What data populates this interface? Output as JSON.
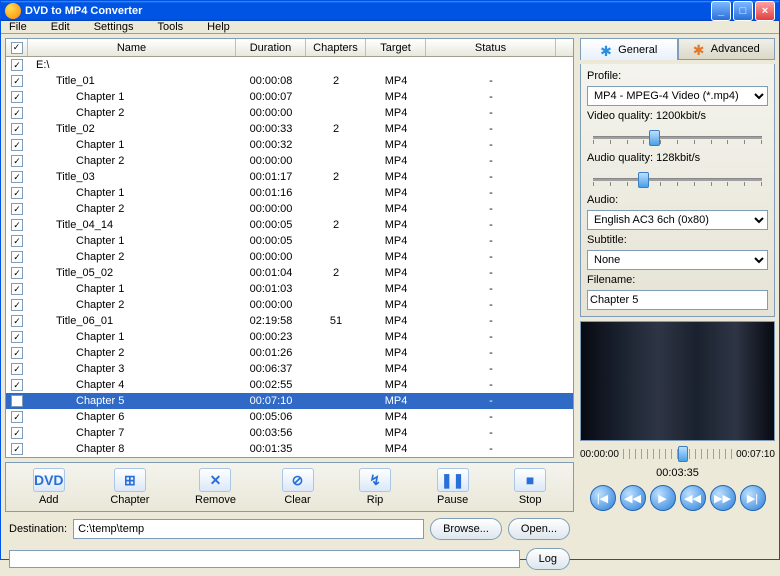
{
  "window": {
    "title": "DVD to MP4 Converter"
  },
  "menu": [
    "File",
    "Edit",
    "Settings",
    "Tools",
    "Help"
  ],
  "columns": {
    "chk": "",
    "name": "Name",
    "duration": "Duration",
    "chapters": "Chapters",
    "target": "Target",
    "status": "Status"
  },
  "rows": [
    {
      "name": "E:\\",
      "indent": 0,
      "duration": "",
      "chapters": "",
      "target": "",
      "status": "",
      "checked": true
    },
    {
      "name": "Title_01",
      "indent": 1,
      "duration": "00:00:08",
      "chapters": "2",
      "target": "MP4",
      "status": "-",
      "checked": true
    },
    {
      "name": "Chapter 1",
      "indent": 2,
      "duration": "00:00:07",
      "chapters": "",
      "target": "MP4",
      "status": "-",
      "checked": true
    },
    {
      "name": "Chapter 2",
      "indent": 2,
      "duration": "00:00:00",
      "chapters": "",
      "target": "MP4",
      "status": "-",
      "checked": true
    },
    {
      "name": "Title_02",
      "indent": 1,
      "duration": "00:00:33",
      "chapters": "2",
      "target": "MP4",
      "status": "-",
      "checked": true
    },
    {
      "name": "Chapter 1",
      "indent": 2,
      "duration": "00:00:32",
      "chapters": "",
      "target": "MP4",
      "status": "-",
      "checked": true
    },
    {
      "name": "Chapter 2",
      "indent": 2,
      "duration": "00:00:00",
      "chapters": "",
      "target": "MP4",
      "status": "-",
      "checked": true
    },
    {
      "name": "Title_03",
      "indent": 1,
      "duration": "00:01:17",
      "chapters": "2",
      "target": "MP4",
      "status": "-",
      "checked": true
    },
    {
      "name": "Chapter 1",
      "indent": 2,
      "duration": "00:01:16",
      "chapters": "",
      "target": "MP4",
      "status": "-",
      "checked": true
    },
    {
      "name": "Chapter 2",
      "indent": 2,
      "duration": "00:00:00",
      "chapters": "",
      "target": "MP4",
      "status": "-",
      "checked": true
    },
    {
      "name": "Title_04_14",
      "indent": 1,
      "duration": "00:00:05",
      "chapters": "2",
      "target": "MP4",
      "status": "-",
      "checked": true
    },
    {
      "name": "Chapter 1",
      "indent": 2,
      "duration": "00:00:05",
      "chapters": "",
      "target": "MP4",
      "status": "-",
      "checked": true
    },
    {
      "name": "Chapter 2",
      "indent": 2,
      "duration": "00:00:00",
      "chapters": "",
      "target": "MP4",
      "status": "-",
      "checked": true
    },
    {
      "name": "Title_05_02",
      "indent": 1,
      "duration": "00:01:04",
      "chapters": "2",
      "target": "MP4",
      "status": "-",
      "checked": true
    },
    {
      "name": "Chapter 1",
      "indent": 2,
      "duration": "00:01:03",
      "chapters": "",
      "target": "MP4",
      "status": "-",
      "checked": true
    },
    {
      "name": "Chapter 2",
      "indent": 2,
      "duration": "00:00:00",
      "chapters": "",
      "target": "MP4",
      "status": "-",
      "checked": true
    },
    {
      "name": "Title_06_01",
      "indent": 1,
      "duration": "02:19:58",
      "chapters": "51",
      "target": "MP4",
      "status": "-",
      "checked": true
    },
    {
      "name": "Chapter 1",
      "indent": 2,
      "duration": "00:00:23",
      "chapters": "",
      "target": "MP4",
      "status": "-",
      "checked": true
    },
    {
      "name": "Chapter 2",
      "indent": 2,
      "duration": "00:01:26",
      "chapters": "",
      "target": "MP4",
      "status": "-",
      "checked": true
    },
    {
      "name": "Chapter 3",
      "indent": 2,
      "duration": "00:06:37",
      "chapters": "",
      "target": "MP4",
      "status": "-",
      "checked": true
    },
    {
      "name": "Chapter 4",
      "indent": 2,
      "duration": "00:02:55",
      "chapters": "",
      "target": "MP4",
      "status": "-",
      "checked": true
    },
    {
      "name": "Chapter 5",
      "indent": 2,
      "duration": "00:07:10",
      "chapters": "",
      "target": "MP4",
      "status": "-",
      "checked": true,
      "selected": true
    },
    {
      "name": "Chapter 6",
      "indent": 2,
      "duration": "00:05:06",
      "chapters": "",
      "target": "MP4",
      "status": "-",
      "checked": true
    },
    {
      "name": "Chapter 7",
      "indent": 2,
      "duration": "00:03:56",
      "chapters": "",
      "target": "MP4",
      "status": "-",
      "checked": true
    },
    {
      "name": "Chapter 8",
      "indent": 2,
      "duration": "00:01:35",
      "chapters": "",
      "target": "MP4",
      "status": "-",
      "checked": true
    }
  ],
  "toolbar": [
    {
      "id": "add",
      "label": "Add",
      "glyph": "DVD"
    },
    {
      "id": "chapter",
      "label": "Chapter",
      "glyph": "⊞"
    },
    {
      "id": "remove",
      "label": "Remove",
      "glyph": "✕"
    },
    {
      "id": "clear",
      "label": "Clear",
      "glyph": "⊘"
    },
    {
      "id": "rip",
      "label": "Rip",
      "glyph": "↯"
    },
    {
      "id": "pause",
      "label": "Pause",
      "glyph": "❚❚"
    },
    {
      "id": "stop",
      "label": "Stop",
      "glyph": "■"
    }
  ],
  "destination": {
    "label": "Destination:",
    "value": "C:\\temp\\temp",
    "browse": "Browse...",
    "open": "Open..."
  },
  "log_button": "Log",
  "tabs": {
    "general": "General",
    "advanced": "Advanced"
  },
  "settings": {
    "profile_label": "Profile:",
    "profile_value": "MP4 - MPEG-4 Video  (*.mp4)",
    "vq_label": "Video quality: 1200kbit/s",
    "aq_label": "Audio quality: 128kbit/s",
    "audio_label": "Audio:",
    "audio_value": "English AC3 6ch (0x80)",
    "subtitle_label": "Subtitle:",
    "subtitle_value": "None",
    "filename_label": "Filename:",
    "filename_value": "Chapter 5"
  },
  "playback": {
    "time_start": "00:00:00",
    "time_current": "00:03:35",
    "time_end": "00:07:10",
    "position_percent": 50
  }
}
